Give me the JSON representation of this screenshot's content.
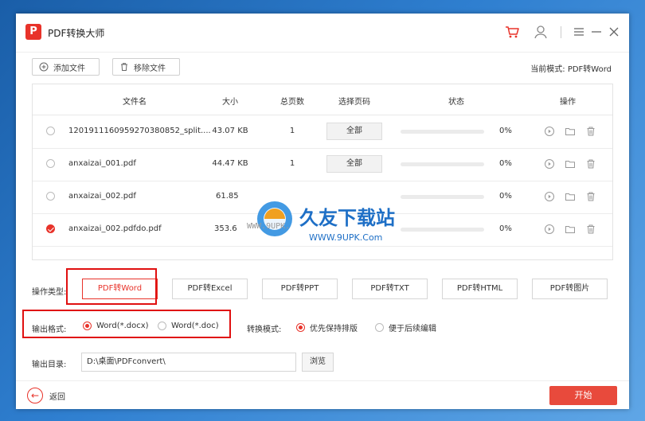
{
  "window": {
    "app_title": "PDF转换大师",
    "logo_text": "P"
  },
  "toolbar": {
    "add_file_label": "添加文件",
    "remove_file_label": "移除文件",
    "current_mode_label": "当前模式: PDF转Word"
  },
  "table": {
    "headers": {
      "filename": "文件名",
      "size": "大小",
      "pages": "总页数",
      "select_pages": "选择页码",
      "status": "状态",
      "actions": "操作"
    },
    "rows": [
      {
        "checked": false,
        "name": "1201911160959270380852_split....",
        "size": "43.07 KB",
        "pages": "1",
        "page_select": "全部",
        "progress": 0,
        "percent": "0%"
      },
      {
        "checked": false,
        "name": "anxaizai_001.pdf",
        "size": "44.47 KB",
        "pages": "1",
        "page_select": "全部",
        "progress": 0,
        "percent": "0%"
      },
      {
        "checked": false,
        "name": "anxaizai_002.pdf",
        "size": "61.85",
        "pages": "",
        "page_select": "",
        "progress": 0,
        "percent": "0%"
      },
      {
        "checked": true,
        "name": "anxaizai_002.pdfdo.pdf",
        "size": "353.6",
        "pages": "",
        "page_select": "",
        "progress": 0,
        "percent": "0%"
      }
    ]
  },
  "operation": {
    "label": "操作类型:",
    "types": [
      "PDF转Word",
      "PDF转Excel",
      "PDF转PPT",
      "PDF转TXT",
      "PDF转HTML",
      "PDF转图片"
    ],
    "active_index": 0
  },
  "output_format": {
    "label": "输出格式:",
    "options": [
      "Word(*.docx)",
      "Word(*.doc)"
    ],
    "selected_index": 0
  },
  "convert_mode": {
    "label": "转换模式:",
    "options": [
      "优先保持排版",
      "便于后续编辑"
    ],
    "selected_index": 0
  },
  "output_dir": {
    "label": "输出目录:",
    "path": "D:\\桌面\\PDFconvert\\",
    "browse_label": "浏览"
  },
  "footer": {
    "back_label": "返回",
    "start_label": "开始"
  },
  "watermark": {
    "title": "久友下载站",
    "url_left": "WWW.9UPK.",
    "url_right": "WWW.9UPK.Com"
  },
  "colors": {
    "accent": "#e8332a",
    "annotation_box": "#e01010"
  },
  "icons": {
    "cart": "cart-icon",
    "user": "user-icon",
    "menu": "menu-icon",
    "minimize": "minimize-icon",
    "close": "close-icon",
    "add": "plus-circle-icon",
    "remove": "trash-icon",
    "play": "play-icon",
    "folder": "folder-icon",
    "delete": "trash-icon"
  }
}
